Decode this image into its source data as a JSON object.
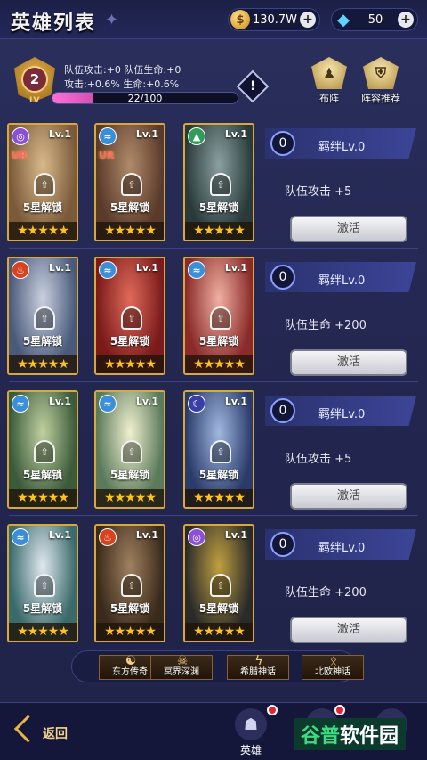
{
  "header": {
    "title": "英雄列表",
    "gold_value": "130.7W",
    "gem_value": "50"
  },
  "team": {
    "level": "2",
    "lv_tag": "LV",
    "line1": "队伍攻击:+0  队伍生命:+0",
    "line2": "攻击:+0.6%    生命:+0.6%",
    "exp_text": "22/100",
    "exp_fraction": 0.22,
    "info_label": "!",
    "formation_label": "布阵",
    "recommend_label": "阵容推荐"
  },
  "card_common": {
    "level": "Lv.1",
    "unlock": "5星解锁",
    "lock_glyph": "⇧",
    "stars": "★★★★★"
  },
  "rows": [
    {
      "bond_num": "0",
      "bond_label": "羁绊Lv.0",
      "bond_desc": "队伍攻击 +5",
      "activate": "激活",
      "cards": [
        {
          "elem": "purple",
          "rarity": "UR"
        },
        {
          "elem": "water",
          "rarity": "UR"
        },
        {
          "elem": "green",
          "rarity": ""
        }
      ]
    },
    {
      "bond_num": "0",
      "bond_label": "羁绊Lv.0",
      "bond_desc": "队伍生命 +200",
      "activate": "激活",
      "cards": [
        {
          "elem": "fire",
          "rarity": ""
        },
        {
          "elem": "water",
          "rarity": ""
        },
        {
          "elem": "water",
          "rarity": ""
        }
      ]
    },
    {
      "bond_num": "0",
      "bond_label": "羁绊Lv.0",
      "bond_desc": "队伍攻击 +5",
      "activate": "激活",
      "cards": [
        {
          "elem": "water",
          "rarity": ""
        },
        {
          "elem": "water",
          "rarity": ""
        },
        {
          "elem": "moon",
          "rarity": ""
        }
      ]
    },
    {
      "bond_num": "0",
      "bond_label": "羁绊Lv.0",
      "bond_desc": "队伍生命 +200",
      "activate": "激活",
      "cards": [
        {
          "elem": "water",
          "rarity": ""
        },
        {
          "elem": "fire",
          "rarity": ""
        },
        {
          "elem": "purple",
          "rarity": ""
        }
      ]
    }
  ],
  "tabs": [
    "东方传奇",
    "冥界深渊",
    "希腊神话",
    "北欧神话"
  ],
  "bottom": {
    "back_label": "返回",
    "nav_hero_label": "英雄"
  },
  "watermark": {
    "part1": "谷普",
    "part2": "软件园"
  },
  "colors": {
    "water": "#3a8fd8",
    "fire": "#d8421e",
    "green": "#2f9c5a",
    "purple": "#8a4fd6",
    "moon": "#3a3fa8",
    "card_border": "#d9a83a",
    "exp_fill": "#ff6fd8"
  }
}
